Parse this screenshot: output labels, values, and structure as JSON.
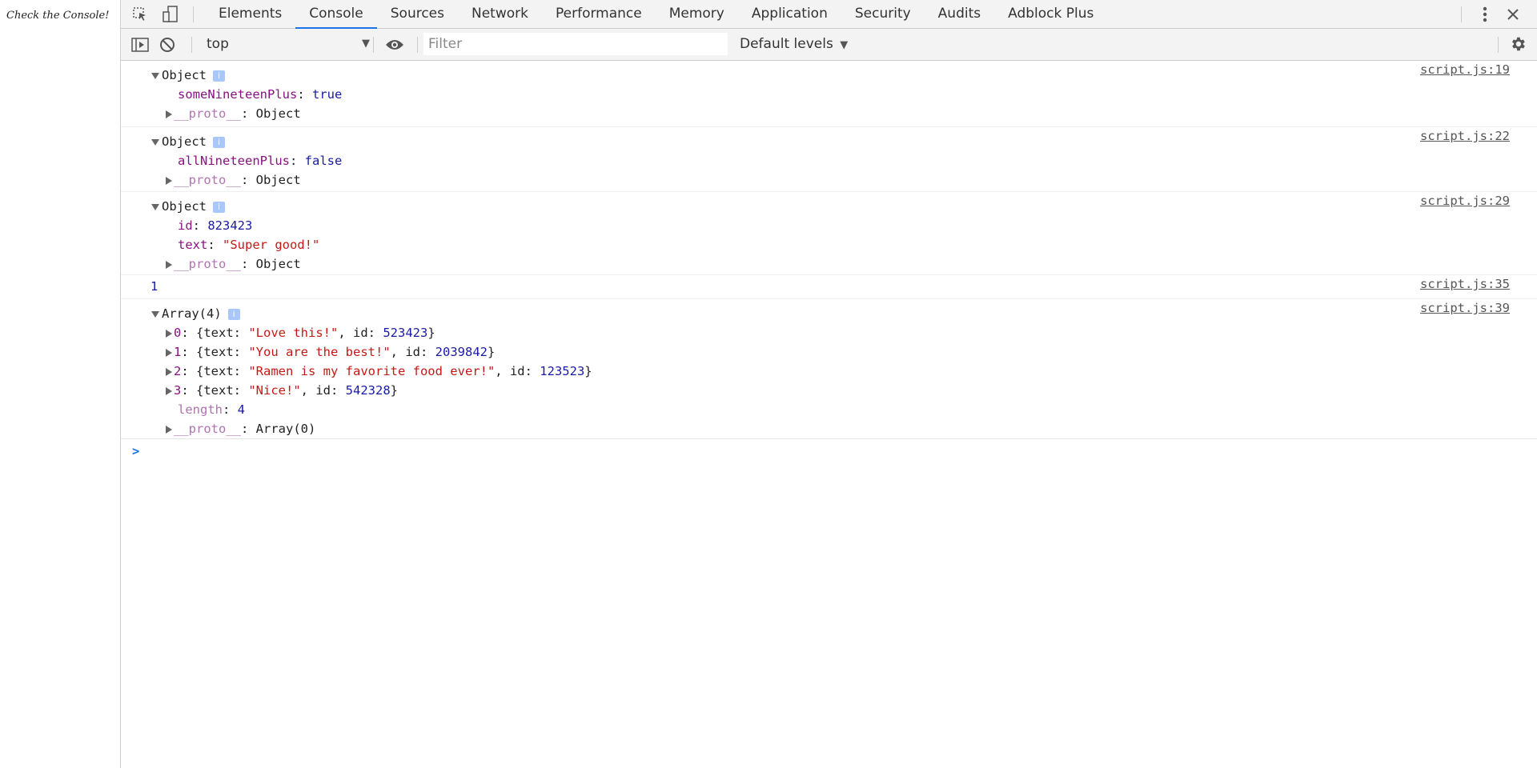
{
  "page": {
    "text": "Check the Console!"
  },
  "tabs": [
    "Elements",
    "Console",
    "Sources",
    "Network",
    "Performance",
    "Memory",
    "Application",
    "Security",
    "Audits",
    "Adblock Plus"
  ],
  "active_tab": "Console",
  "toolbar": {
    "context": "top",
    "filter_placeholder": "Filter",
    "levels": "Default levels"
  },
  "icons": {
    "inspect": "cursor-select-icon",
    "device": "device-toolbar-icon",
    "more": "vertical-dots-icon",
    "close": "close-icon",
    "sidebar": "show-sidebar-icon",
    "clear": "clear-console-icon",
    "eye": "live-expression-icon",
    "settings": "gear-icon"
  },
  "messages": {
    "m1": {
      "head": "Object",
      "src": "script.js:19",
      "key": "someNineteenPlus",
      "val": "true",
      "proto_key": "__proto__",
      "proto_val": "Object"
    },
    "m2": {
      "head": "Object",
      "src": "script.js:22",
      "key": "allNineteenPlus",
      "val": "false",
      "proto_key": "__proto__",
      "proto_val": "Object"
    },
    "m3": {
      "head": "Object",
      "src": "script.js:29",
      "k1": "id",
      "v1": "823423",
      "k2": "text",
      "v2": "\"Super good!\"",
      "proto_key": "__proto__",
      "proto_val": "Object"
    },
    "m4": {
      "value": "1",
      "src": "script.js:35"
    },
    "m5": {
      "head": "Array(4)",
      "src": "script.js:39",
      "items": [
        {
          "index": "0",
          "text": "\"Love this!\"",
          "id": "523423"
        },
        {
          "index": "1",
          "text": "\"You are the best!\"",
          "id": "2039842"
        },
        {
          "index": "2",
          "text": "\"Ramen is my favorite food ever!\"",
          "id": "123523"
        },
        {
          "index": "3",
          "text": "\"Nice!\"",
          "id": "542328"
        }
      ],
      "length_key": "length",
      "length_val": "4",
      "proto_key": "__proto__",
      "proto_val": "Array(0)"
    }
  },
  "prompt": ">"
}
